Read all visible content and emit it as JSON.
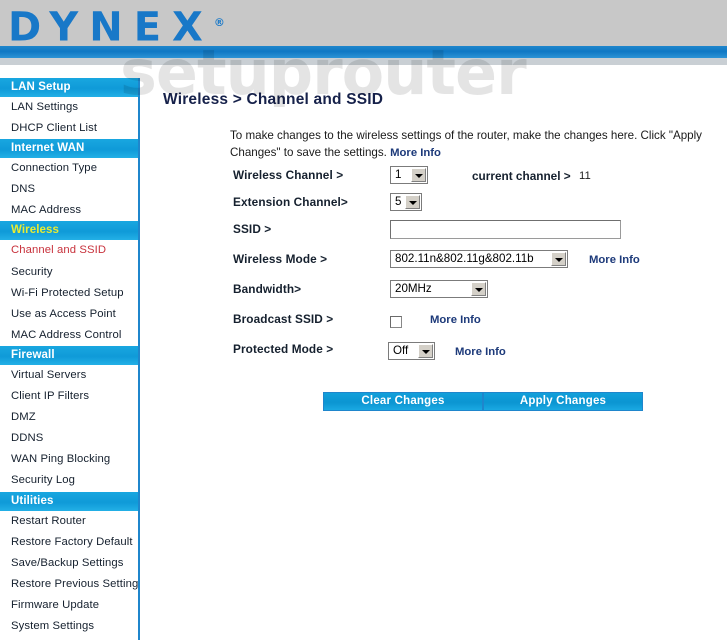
{
  "brand": {
    "logo_text": "DYNEX",
    "trademark": "®"
  },
  "watermark": "setuprouter",
  "sidebar": {
    "groups": [
      {
        "header": "LAN Setup",
        "style": "default",
        "items": [
          {
            "label": "LAN Settings",
            "active": false
          },
          {
            "label": "DHCP Client List",
            "active": false
          }
        ]
      },
      {
        "header": "Internet WAN",
        "style": "default",
        "items": [
          {
            "label": "Connection Type",
            "active": false
          },
          {
            "label": "DNS",
            "active": false
          },
          {
            "label": "MAC Address",
            "active": false
          }
        ]
      },
      {
        "header": "Wireless",
        "style": "wireless",
        "items": [
          {
            "label": "Channel and SSID",
            "active": true
          },
          {
            "label": "Security",
            "active": false
          },
          {
            "label": "Wi-Fi Protected Setup",
            "active": false
          },
          {
            "label": "Use as Access Point",
            "active": false
          },
          {
            "label": "MAC Address Control",
            "active": false
          }
        ]
      },
      {
        "header": "Firewall",
        "style": "default",
        "items": [
          {
            "label": "Virtual Servers",
            "active": false
          },
          {
            "label": "Client IP Filters",
            "active": false
          },
          {
            "label": "DMZ",
            "active": false
          },
          {
            "label": "DDNS",
            "active": false
          },
          {
            "label": "WAN Ping Blocking",
            "active": false
          },
          {
            "label": "Security Log",
            "active": false
          }
        ]
      },
      {
        "header": "Utilities",
        "style": "default",
        "items": [
          {
            "label": "Restart Router",
            "active": false
          },
          {
            "label": "Restore Factory Default",
            "active": false
          },
          {
            "label": "Save/Backup Settings",
            "active": false
          },
          {
            "label": "Restore Previous Settings",
            "active": false
          },
          {
            "label": "Firmware Update",
            "active": false
          },
          {
            "label": "System Settings",
            "active": false
          }
        ]
      }
    ]
  },
  "main": {
    "title": "Wireless > Channel and SSID",
    "intro_text": "To make changes to the wireless settings of the router, make the changes here. Click \"Apply Changes\" to save the settings.",
    "more_info_label": "More Info",
    "fields": {
      "wireless_channel": {
        "label": "Wireless Channel >",
        "value": "1",
        "current_channel_label": "current channel >",
        "current_channel_value": "11"
      },
      "extension_channel": {
        "label": "Extension Channel>",
        "value": "5"
      },
      "ssid": {
        "label": "SSID >",
        "value": "",
        "placeholder": ""
      },
      "wireless_mode": {
        "label": "Wireless Mode >",
        "value": "802.11n&802.11g&802.11b",
        "more_info_label": "More Info"
      },
      "bandwidth": {
        "label": "Bandwidth>",
        "value": "20MHz"
      },
      "broadcast_ssid": {
        "label": "Broadcast SSID >",
        "checked": false,
        "more_info_label": "More Info"
      },
      "protected_mode": {
        "label": "Protected Mode >",
        "value": "Off",
        "more_info_label": "More Info"
      }
    },
    "buttons": {
      "clear": "Clear Changes",
      "apply": "Apply Changes"
    }
  },
  "colors": {
    "accent_blue": "#0f9ad8",
    "header_gray": "#c8c8c8",
    "logo_blue": "#1878c8",
    "active_item_red": "#c8323c",
    "wireless_yellow": "#e8ec33",
    "link_navy": "#1d3a7a"
  }
}
